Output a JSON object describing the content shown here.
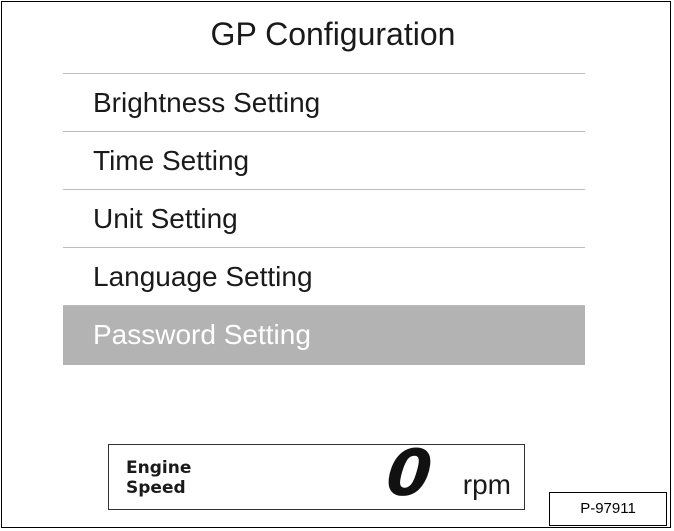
{
  "screen": {
    "title": "GP Configuration"
  },
  "menu": {
    "items": [
      {
        "label": "Brightness Setting",
        "selected": false
      },
      {
        "label": "Time Setting",
        "selected": false
      },
      {
        "label": "Unit Setting",
        "selected": false
      },
      {
        "label": "Language Setting",
        "selected": false
      },
      {
        "label": "Password Setting",
        "selected": true
      }
    ]
  },
  "status_bar": {
    "label": "Engine Speed",
    "value": "0",
    "unit": "rpm"
  },
  "figure_ref": "P-97911",
  "colors": {
    "selected_background": "#b3b3b3",
    "selected_text": "#ffffff",
    "divider": "#bdbdbd"
  }
}
